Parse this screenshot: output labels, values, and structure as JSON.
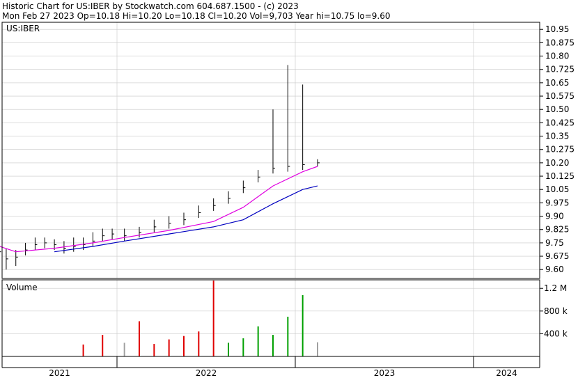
{
  "header": {
    "line1": "Historic Chart for US:IBER by Stockwatch.com 604.687.1500 - (c) 2023",
    "line2": "Mon Feb 27 2023   Op=10.18  Hi=10.20  Lo=10.18  Cl=10.20  Vol=9,703  Year hi=10.75  lo=9.60"
  },
  "panels": {
    "price_label": "US:IBER",
    "volume_label": "Volume"
  },
  "colors": {
    "up_volume": "#00a000",
    "down_volume": "#e00000",
    "flat_volume": "#a0a0a0",
    "ma_short": "#e000e0",
    "ma_long": "#0000c0",
    "price_bar": "#000000",
    "grid": "#c8c8c8"
  },
  "chart_data": [
    {
      "type": "line",
      "title": "US:IBER",
      "y_ticks": [
        "9.60",
        "9.675",
        "9.75",
        "9.825",
        "9.90",
        "9.975",
        "10.05",
        "10.125",
        "10.20",
        "10.275",
        "10.35",
        "10.425",
        "10.50",
        "10.575",
        "10.65",
        "10.725",
        "10.80",
        "10.875",
        "10.95"
      ],
      "ylim": [
        9.55,
        10.99
      ],
      "x_labels": [
        "2021",
        "2022",
        "2023",
        "2024"
      ],
      "series": [
        {
          "kind": "price_bars",
          "x": [
            "2020-11",
            "2020-12",
            "2021-01",
            "2021-02",
            "2021-03",
            "2021-04",
            "2021-05",
            "2021-06",
            "2021-07",
            "2021-08",
            "2021-09",
            "2021-10",
            "2021-11",
            "2021-12",
            "2022-01",
            "2022-02",
            "2022-03",
            "2022-04",
            "2022-05",
            "2022-06",
            "2022-07",
            "2022-08",
            "2022-09",
            "2022-10",
            "2022-11",
            "2022-12",
            "2023-01",
            "2023-02"
          ],
          "close": [
            9.74,
            9.7,
            9.66,
            9.67,
            9.71,
            9.74,
            9.75,
            9.74,
            9.72,
            9.73,
            9.74,
            9.76,
            9.79,
            9.8,
            9.79,
            9.81,
            9.84,
            9.86,
            9.88,
            9.92,
            9.96,
            10.0,
            10.06,
            10.12,
            10.17,
            10.18,
            10.19,
            10.2
          ],
          "high": [
            9.76,
            9.82,
            9.72,
            9.71,
            9.75,
            9.78,
            9.78,
            9.77,
            9.76,
            9.78,
            9.78,
            9.81,
            9.83,
            9.83,
            9.83,
            9.84,
            9.88,
            9.9,
            9.92,
            9.96,
            10.0,
            10.04,
            10.1,
            10.16,
            10.5,
            10.75,
            10.64,
            10.22
          ],
          "low": [
            9.72,
            9.6,
            9.6,
            9.62,
            9.68,
            9.71,
            9.72,
            9.71,
            9.69,
            9.7,
            9.71,
            9.73,
            9.76,
            9.77,
            9.76,
            9.78,
            9.81,
            9.83,
            9.85,
            9.89,
            9.93,
            9.97,
            10.03,
            10.09,
            10.14,
            10.15,
            10.16,
            10.18
          ]
        },
        {
          "kind": "moving_average_short",
          "x": [
            "2020-11",
            "2021-02",
            "2021-06",
            "2021-10",
            "2022-01",
            "2022-04",
            "2022-07",
            "2022-09",
            "2022-11",
            "2023-01",
            "2023-02"
          ],
          "values": [
            9.74,
            9.7,
            9.72,
            9.75,
            9.78,
            9.82,
            9.87,
            9.95,
            10.07,
            10.15,
            10.18
          ]
        },
        {
          "kind": "moving_average_long",
          "x": [
            "2021-06",
            "2021-10",
            "2022-01",
            "2022-04",
            "2022-07",
            "2022-09",
            "2022-11",
            "2023-01",
            "2023-02"
          ],
          "values": [
            9.7,
            9.73,
            9.76,
            9.8,
            9.84,
            9.88,
            9.97,
            10.05,
            10.07
          ]
        }
      ]
    },
    {
      "type": "bar",
      "title": "Volume",
      "y_ticks": [
        "400 k",
        "800 k",
        "1.2 M"
      ],
      "ylim": [
        0,
        1350000
      ],
      "x_labels": [
        "2021",
        "2022",
        "2023",
        "2024"
      ],
      "spikes": [
        {
          "x": "2021-09",
          "value": 210000,
          "dir": "down"
        },
        {
          "x": "2021-11",
          "value": 380000,
          "dir": "down"
        },
        {
          "x": "2022-01",
          "value": 240000,
          "dir": "flat"
        },
        {
          "x": "2022-02",
          "value": 620000,
          "dir": "down"
        },
        {
          "x": "2022-03",
          "value": 220000,
          "dir": "down"
        },
        {
          "x": "2022-04",
          "value": 300000,
          "dir": "down"
        },
        {
          "x": "2022-05",
          "value": 360000,
          "dir": "down"
        },
        {
          "x": "2022-06",
          "value": 440000,
          "dir": "down"
        },
        {
          "x": "2022-07",
          "value": 1400000,
          "dir": "down"
        },
        {
          "x": "2022-08",
          "value": 240000,
          "dir": "up"
        },
        {
          "x": "2022-09",
          "value": 320000,
          "dir": "up"
        },
        {
          "x": "2022-10",
          "value": 530000,
          "dir": "up"
        },
        {
          "x": "2022-11",
          "value": 380000,
          "dir": "up"
        },
        {
          "x": "2022-12",
          "value": 700000,
          "dir": "up"
        },
        {
          "x": "2023-01",
          "value": 1080000,
          "dir": "up"
        },
        {
          "x": "2023-02",
          "value": 250000,
          "dir": "flat"
        }
      ]
    }
  ]
}
